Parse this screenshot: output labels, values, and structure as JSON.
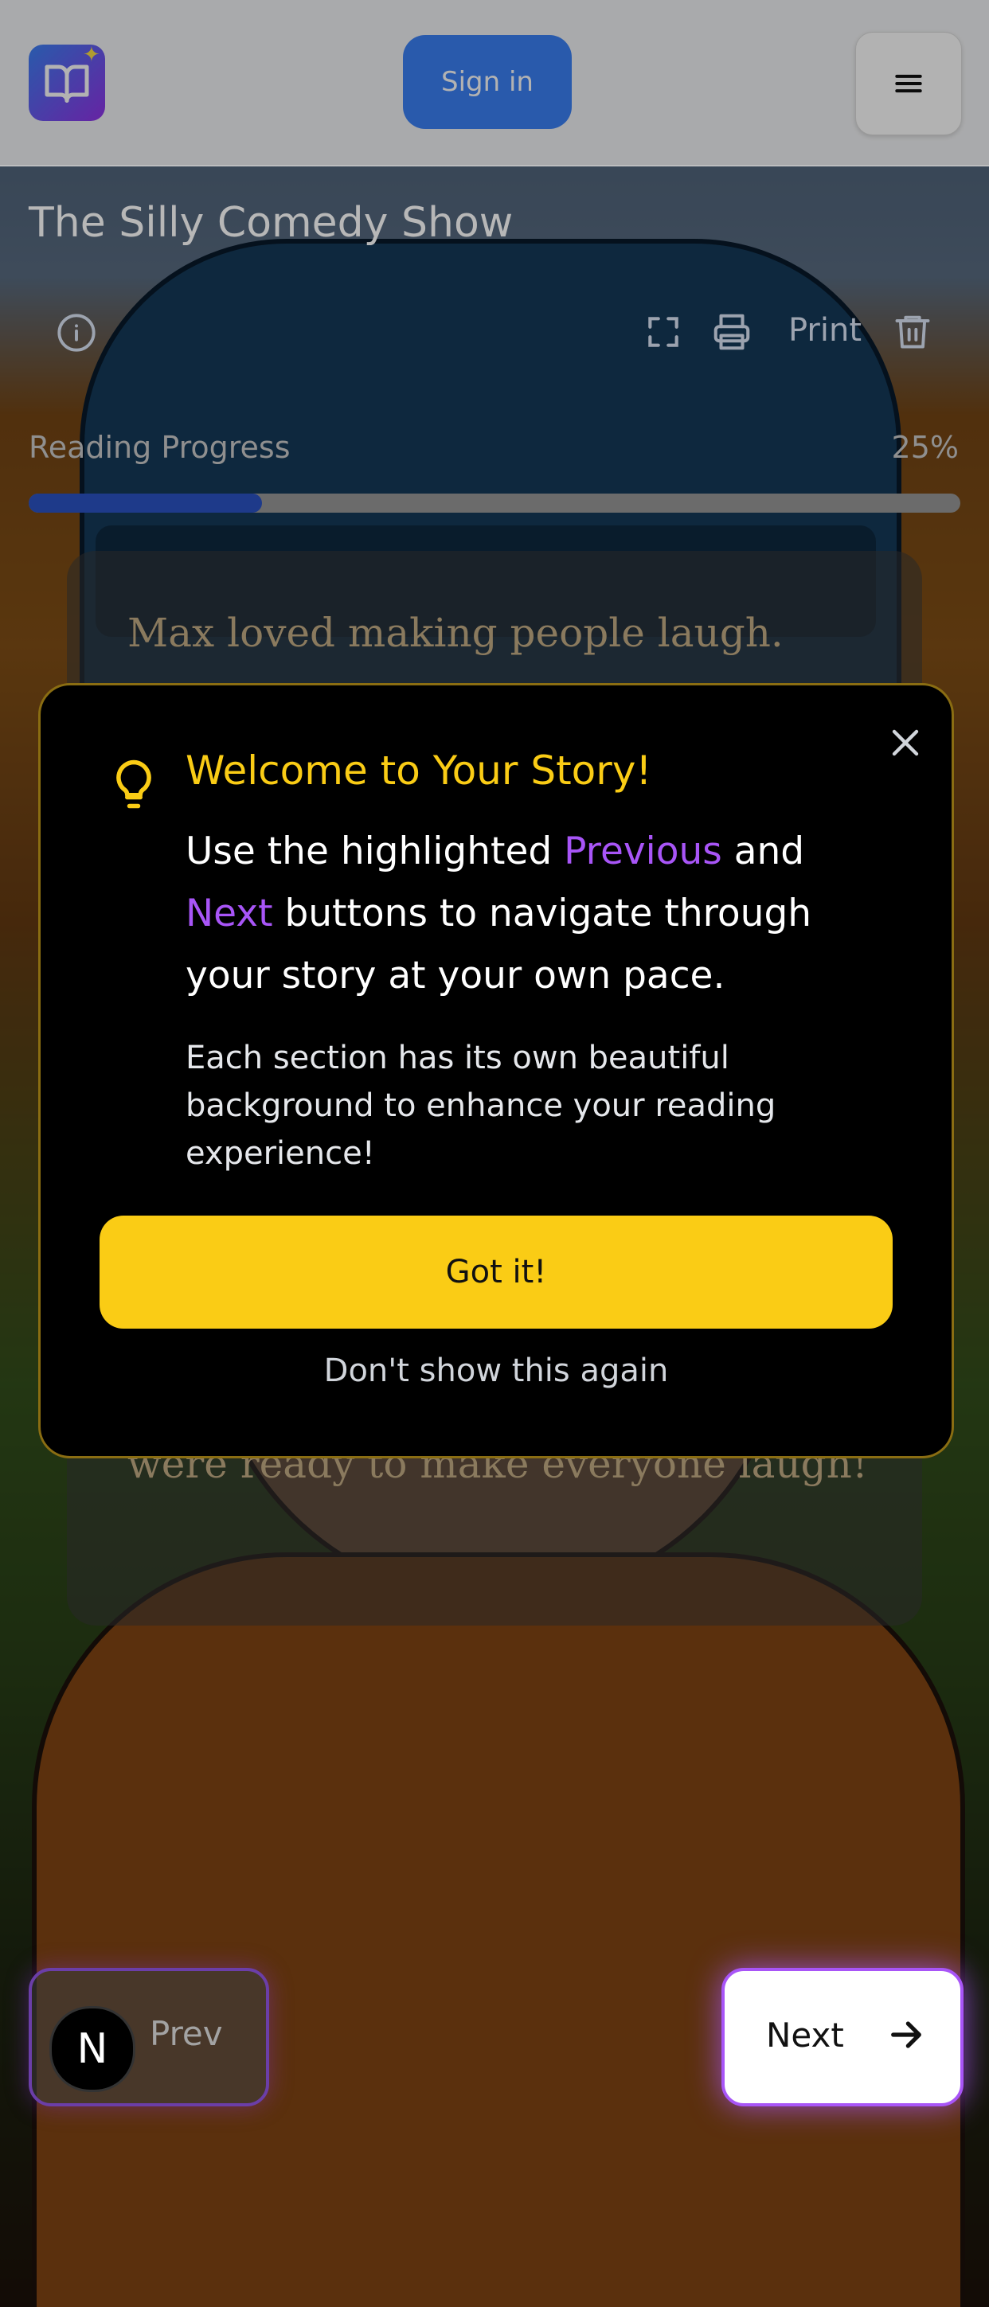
{
  "header": {
    "logo_icon": "book-open-icon",
    "signin_label": "Sign in",
    "menu_icon": "hamburger-menu-icon"
  },
  "story": {
    "title": "The Silly Comedy Show",
    "toolbar": {
      "info_icon": "info-icon",
      "fullscreen_icon": "fullscreen-icon",
      "print_icon": "printer-icon",
      "print_label": "Print",
      "delete_icon": "trash-icon"
    },
    "progress": {
      "label": "Reading Progress",
      "percent_text": "25%",
      "value": 0.25
    },
    "text": "Max loved making people laugh. One day, he had an idea. \"Let's create a comedy show!\" he said. His friends, Lily and Ben, came over. They sat in Max's backyard with big smiles. They needed a plan. \"What if we tell funny jokes?\" asked Lily. \"Or act out silly skits,\" suggested Ben. They decided to try both. They grabbed costumes. Max wore a giant hat. Lily wore funny glasses. Ben carried a rubber chicken. They were ready to make everyone laugh!"
  },
  "nav": {
    "prev_label": "Prev",
    "prev_badge": "N",
    "next_label": "Next"
  },
  "modal": {
    "title": "Welcome to Your Story!",
    "body_pre": "Use the highlighted ",
    "body_previous": "Previous",
    "body_and": " and ",
    "body_next": "Next",
    "body_post": " buttons to navigate through your story at your own pace.",
    "sub": "Each section has its own beautiful background to enhance your reading experience!",
    "confirm_label": "Got it!",
    "dismiss_label": "Don't show this again"
  },
  "colors": {
    "accent_yellow": "#facc15",
    "accent_purple": "#a855f7",
    "signin_blue": "#3b82f6"
  }
}
